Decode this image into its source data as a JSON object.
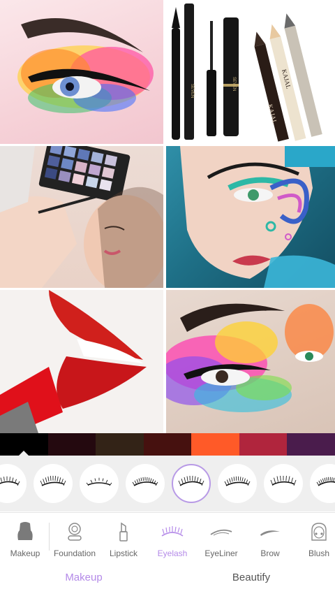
{
  "collage": {
    "tiles": [
      {
        "name": "rainbow-eyeshadow-photo"
      },
      {
        "name": "eyeliner-mascara-kajal-photo",
        "brand_text": [
          "SEVEN",
          "SEVEN",
          "KAJAL",
          "KAJAL"
        ]
      },
      {
        "name": "makeup-artist-palette-photo"
      },
      {
        "name": "face-paint-swirl-photo"
      },
      {
        "name": "red-lipstick-photo"
      },
      {
        "name": "colorful-eye-art-photo"
      }
    ]
  },
  "colors": {
    "accent": "#b48ae8",
    "swatches": [
      "#000000",
      "#24090f",
      "#332317",
      "#46110f",
      "#ff5a28",
      "#b0253d",
      "#4a1c4c"
    ],
    "selected_swatch_index": 0
  },
  "lash_styles": {
    "count": 8,
    "selected_index": 3,
    "icon": "eyelash-style-icon"
  },
  "categories": [
    {
      "id": "makeup",
      "label": "Makeup",
      "icon": "makeup-silhouette-icon"
    },
    {
      "id": "foundation",
      "label": "Foundation",
      "icon": "compact-icon"
    },
    {
      "id": "lipstick",
      "label": "Lipstick",
      "icon": "lipstick-icon"
    },
    {
      "id": "eyelash",
      "label": "Eyelash",
      "icon": "eyelash-icon",
      "active": true
    },
    {
      "id": "eyeliner",
      "label": "EyeLiner",
      "icon": "eyeliner-icon"
    },
    {
      "id": "brow",
      "label": "Brow",
      "icon": "brow-icon"
    },
    {
      "id": "blush",
      "label": "Blush",
      "icon": "face-blush-icon"
    }
  ],
  "tabs": [
    {
      "label": "Makeup",
      "active": true
    },
    {
      "label": "Beautify",
      "active": false
    }
  ]
}
